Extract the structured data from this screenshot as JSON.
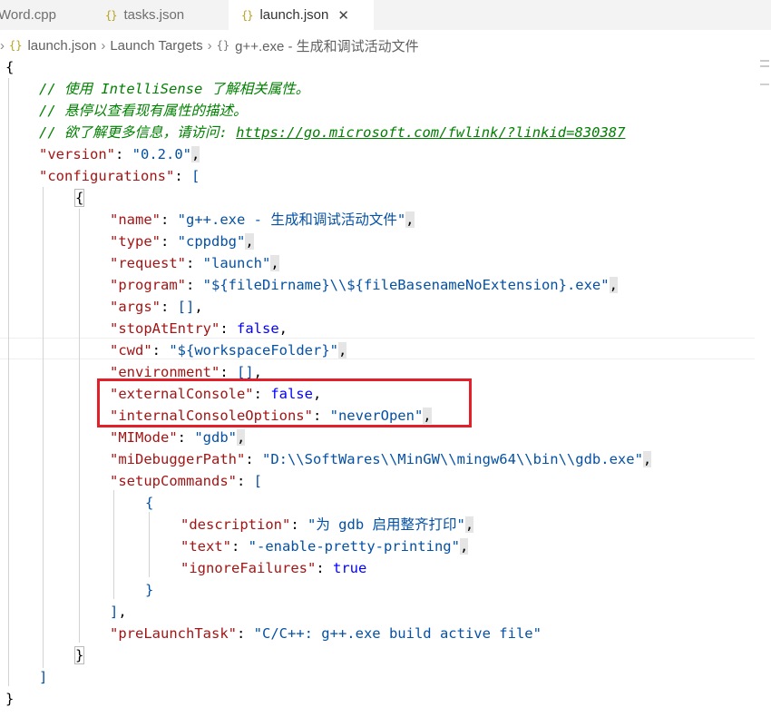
{
  "tabs": [
    {
      "label": "Word.cpp"
    },
    {
      "label": "tasks.json",
      "icon": "{}"
    },
    {
      "label": "launch.json",
      "icon": "{}",
      "close": "✕"
    }
  ],
  "breadcrumb": {
    "file_icon": "{}",
    "file": "launch.json",
    "target": "Launch Targets",
    "config_icon": "{}",
    "config": "g++.exe - 生成和调试活动文件"
  },
  "code": {
    "open_brace": "{",
    "comment1": "// 使用 IntelliSense 了解相关属性。",
    "comment2": "// 悬停以查看现有属性的描述。",
    "comment3_prefix": "// 欲了解更多信息，请访问: ",
    "comment3_link": "https://go.microsoft.com/fwlink/?linkid=830387",
    "version_key": "\"version\"",
    "version_val": "\"0.2.0\"",
    "configurations_key": "\"configurations\"",
    "name_key": "\"name\"",
    "name_val": "\"g++.exe - 生成和调试活动文件\"",
    "type_key": "\"type\"",
    "type_val": "\"cppdbg\"",
    "request_key": "\"request\"",
    "request_val": "\"launch\"",
    "program_key": "\"program\"",
    "program_val": "\"${fileDirname}\\\\${fileBasenameNoExtension}.exe\"",
    "args_key": "\"args\"",
    "args_val": "[]",
    "stopAtEntry_key": "\"stopAtEntry\"",
    "stopAtEntry_val": "false",
    "cwd_key": "\"cwd\"",
    "cwd_val": "\"${workspaceFolder}\"",
    "environment_key": "\"environment\"",
    "environment_val": "[]",
    "externalConsole_key": "\"externalConsole\"",
    "externalConsole_val": "false",
    "internalConsoleOptions_key": "\"internalConsoleOptions\"",
    "internalConsoleOptions_val": "\"neverOpen\"",
    "MIMode_key": "\"MIMode\"",
    "MIMode_val": "\"gdb\"",
    "miDebuggerPath_key": "\"miDebuggerPath\"",
    "miDebuggerPath_val": "\"D:\\\\SoftWares\\\\MinGW\\\\mingw64\\\\bin\\\\gdb.exe\"",
    "setupCommands_key": "\"setupCommands\"",
    "description_key": "\"description\"",
    "description_val": "\"为 gdb 启用整齐打印\"",
    "text_key": "\"text\"",
    "text_val": "\"-enable-pretty-printing\"",
    "ignoreFailures_key": "\"ignoreFailures\"",
    "ignoreFailures_val": "true",
    "preLaunchTask_key": "\"preLaunchTask\"",
    "preLaunchTask_val": "\"C/C++: g++.exe build active file\""
  },
  "colors": {
    "key": "#a31515",
    "string": "#0451a5",
    "comment": "#008000",
    "keyword": "#0000ff",
    "highlight_box": "#e3202a"
  }
}
